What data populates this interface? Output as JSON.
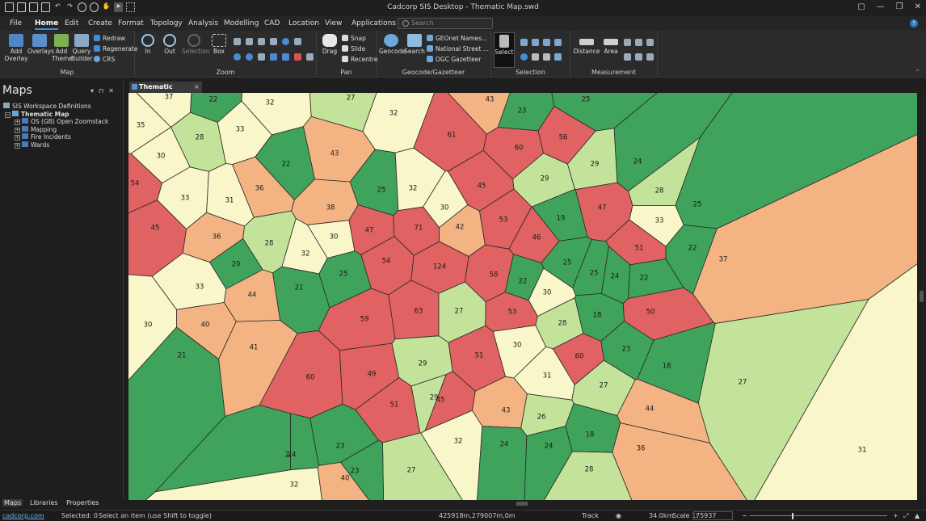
{
  "window": {
    "title": "Cadcorp SIS Desktop - Thematic Map.swd",
    "controls": [
      "▢",
      "—",
      "❐",
      "✕"
    ]
  },
  "menu": {
    "tabs": [
      "File",
      "Home",
      "Edit",
      "Create",
      "Format",
      "Topology",
      "Analysis",
      "Modelling",
      "CAD",
      "Location",
      "View",
      "Applications"
    ],
    "active": "Home",
    "search_placeholder": "Search",
    "help": "?"
  },
  "ribbon": {
    "map": {
      "label": "Map",
      "add_overlay": "Add Overlay",
      "overlays": "Overlays",
      "add_theme": "Add Theme",
      "query_builder": "Query Builder",
      "redraw": "Redraw",
      "regenerate": "Regenerate",
      "crs": "CRS"
    },
    "zoom": {
      "label": "Zoom",
      "in": "In",
      "out": "Out",
      "selection": "Selection",
      "box": "Box"
    },
    "pan": {
      "label": "Pan",
      "drag": "Drag",
      "snap": "Snap",
      "slide": "Slide",
      "recentre": "Recentre"
    },
    "geocode": {
      "label": "Geocode/Gazetteer",
      "geocode": "Geocode",
      "search": "Search",
      "geonet": "GEOnet Names...",
      "national_street": "National Street ...",
      "ogc": "OGC Gazetteer"
    },
    "selection": {
      "label": "Selection",
      "select": "Select"
    },
    "measurement": {
      "label": "Measurement",
      "distance": "Distance",
      "area": "Area"
    }
  },
  "leftpanel": {
    "title": "Maps",
    "tree": [
      {
        "label": "SIS Workspace Definitions",
        "level": 0,
        "expander": ""
      },
      {
        "label": "Thematic Map",
        "level": 1,
        "expander": "−",
        "bold": true
      },
      {
        "label": "OS (GB) Open Zoomstack",
        "level": 2,
        "expander": "+"
      },
      {
        "label": "Mapping",
        "level": 2,
        "expander": "+"
      },
      {
        "label": "Fire Incidents",
        "level": 2,
        "expander": "+"
      },
      {
        "label": "Wards",
        "level": 2,
        "expander": "+"
      }
    ],
    "bottom_tabs": [
      "Maps",
      "Libraries",
      "Properties"
    ]
  },
  "doc_tab": {
    "label": "Thematic Map.swd",
    "close": "×"
  },
  "map": {
    "palette": {
      "red": "#e06262",
      "orange": "#f4b382",
      "yellow": "#f9f6c9",
      "lightgreen": "#c4e39a",
      "green": "#3fa35c"
    },
    "wards": [
      {
        "v": 37,
        "c": "yellow"
      },
      {
        "v": 22,
        "c": "green"
      },
      {
        "v": 32,
        "c": "yellow"
      },
      {
        "v": 27,
        "c": "lightgreen"
      },
      {
        "v": 32,
        "c": "yellow"
      },
      {
        "v": 43,
        "c": "orange"
      },
      {
        "v": 23,
        "c": "green"
      },
      {
        "v": 25,
        "c": "green"
      },
      {
        "v": 35,
        "c": "yellow"
      },
      {
        "v": 28,
        "c": "lightgreen"
      },
      {
        "v": 33,
        "c": "yellow"
      },
      {
        "v": 30,
        "c": "yellow"
      },
      {
        "v": 43,
        "c": "orange"
      },
      {
        "v": 61,
        "c": "red"
      },
      {
        "v": 60,
        "c": "red"
      },
      {
        "v": 56,
        "c": "red"
      },
      {
        "v": 22,
        "c": "green"
      },
      {
        "v": 29,
        "c": "lightgreen"
      },
      {
        "v": 29,
        "c": "lightgreen"
      },
      {
        "v": 24,
        "c": "green"
      },
      {
        "v": 54,
        "c": "red"
      },
      {
        "v": 33,
        "c": "yellow"
      },
      {
        "v": 31,
        "c": "yellow"
      },
      {
        "v": 36,
        "c": "orange"
      },
      {
        "v": 25,
        "c": "green"
      },
      {
        "v": 32,
        "c": "yellow"
      },
      {
        "v": 30,
        "c": "yellow"
      },
      {
        "v": 45,
        "c": "red"
      },
      {
        "v": 28,
        "c": "lightgreen"
      },
      {
        "v": 25,
        "c": "green"
      },
      {
        "v": 47,
        "c": "red"
      },
      {
        "v": 19,
        "c": "green"
      },
      {
        "v": 33,
        "c": "yellow"
      },
      {
        "v": 45,
        "c": "red"
      },
      {
        "v": 36,
        "c": "orange"
      },
      {
        "v": 38,
        "c": "orange"
      },
      {
        "v": 30,
        "c": "yellow"
      },
      {
        "v": 47,
        "c": "red"
      },
      {
        "v": 71,
        "c": "red"
      },
      {
        "v": 42,
        "c": "orange"
      },
      {
        "v": 53,
        "c": "red"
      },
      {
        "v": 46,
        "c": "red"
      },
      {
        "v": 51,
        "c": "red"
      },
      {
        "v": 22,
        "c": "green"
      },
      {
        "v": 37,
        "c": "orange"
      },
      {
        "v": 28,
        "c": "lightgreen"
      },
      {
        "v": 32,
        "c": "yellow"
      },
      {
        "v": 20,
        "c": "green"
      },
      {
        "v": 54,
        "c": "red"
      },
      {
        "v": 124,
        "c": "red"
      },
      {
        "v": 58,
        "c": "red"
      },
      {
        "v": 25,
        "c": "green"
      },
      {
        "v": 25,
        "c": "green"
      },
      {
        "v": 24,
        "c": "green"
      },
      {
        "v": 22,
        "c": "green"
      },
      {
        "v": 33,
        "c": "yellow"
      },
      {
        "v": 21,
        "c": "green"
      },
      {
        "v": 25,
        "c": "green"
      },
      {
        "v": 22,
        "c": "green"
      },
      {
        "v": 30,
        "c": "yellow"
      },
      {
        "v": 44,
        "c": "orange"
      },
      {
        "v": 63,
        "c": "red"
      },
      {
        "v": 27,
        "c": "lightgreen"
      },
      {
        "v": 53,
        "c": "red"
      },
      {
        "v": 18,
        "c": "green"
      },
      {
        "v": 50,
        "c": "red"
      },
      {
        "v": 30,
        "c": "yellow"
      },
      {
        "v": 40,
        "c": "orange"
      },
      {
        "v": 59,
        "c": "red"
      },
      {
        "v": 28,
        "c": "lightgreen"
      },
      {
        "v": 41,
        "c": "orange"
      },
      {
        "v": 30,
        "c": "yellow"
      },
      {
        "v": 60,
        "c": "red"
      },
      {
        "v": 23,
        "c": "green"
      },
      {
        "v": 21,
        "c": "green"
      },
      {
        "v": 51,
        "c": "red"
      },
      {
        "v": 18,
        "c": "green"
      },
      {
        "v": 60,
        "c": "red"
      },
      {
        "v": 49,
        "c": "red"
      },
      {
        "v": 29,
        "c": "lightgreen"
      },
      {
        "v": 31,
        "c": "yellow"
      },
      {
        "v": 27,
        "c": "lightgreen"
      },
      {
        "v": 27,
        "c": "lightgreen"
      },
      {
        "v": 51,
        "c": "red"
      },
      {
        "v": 29,
        "c": "lightgreen"
      },
      {
        "v": 45,
        "c": "red"
      },
      {
        "v": 43,
        "c": "orange"
      },
      {
        "v": 26,
        "c": "lightgreen"
      },
      {
        "v": 44,
        "c": "orange"
      },
      {
        "v": 23,
        "c": "green"
      },
      {
        "v": 18,
        "c": "green"
      },
      {
        "v": 24,
        "c": "green"
      },
      {
        "v": 32,
        "c": "yellow"
      },
      {
        "v": 24,
        "c": "green"
      },
      {
        "v": 24,
        "c": "green"
      },
      {
        "v": 36,
        "c": "orange"
      },
      {
        "v": 31,
        "c": "yellow"
      },
      {
        "v": 24,
        "c": "green"
      },
      {
        "v": 27,
        "c": "lightgreen"
      },
      {
        "v": 28,
        "c": "lightgreen"
      },
      {
        "v": 32,
        "c": "yellow"
      },
      {
        "v": 40,
        "c": "orange"
      },
      {
        "v": 23,
        "c": "green"
      }
    ]
  },
  "status": {
    "link": "cadcorp.com",
    "selected": "Selected: 0",
    "hint": "Select an item (use Shift to toggle)",
    "coords": "425918m,279007m,0m",
    "track": "Track",
    "distance": "34.0km",
    "scale_label": "Scale 1:",
    "scale": "75937"
  }
}
